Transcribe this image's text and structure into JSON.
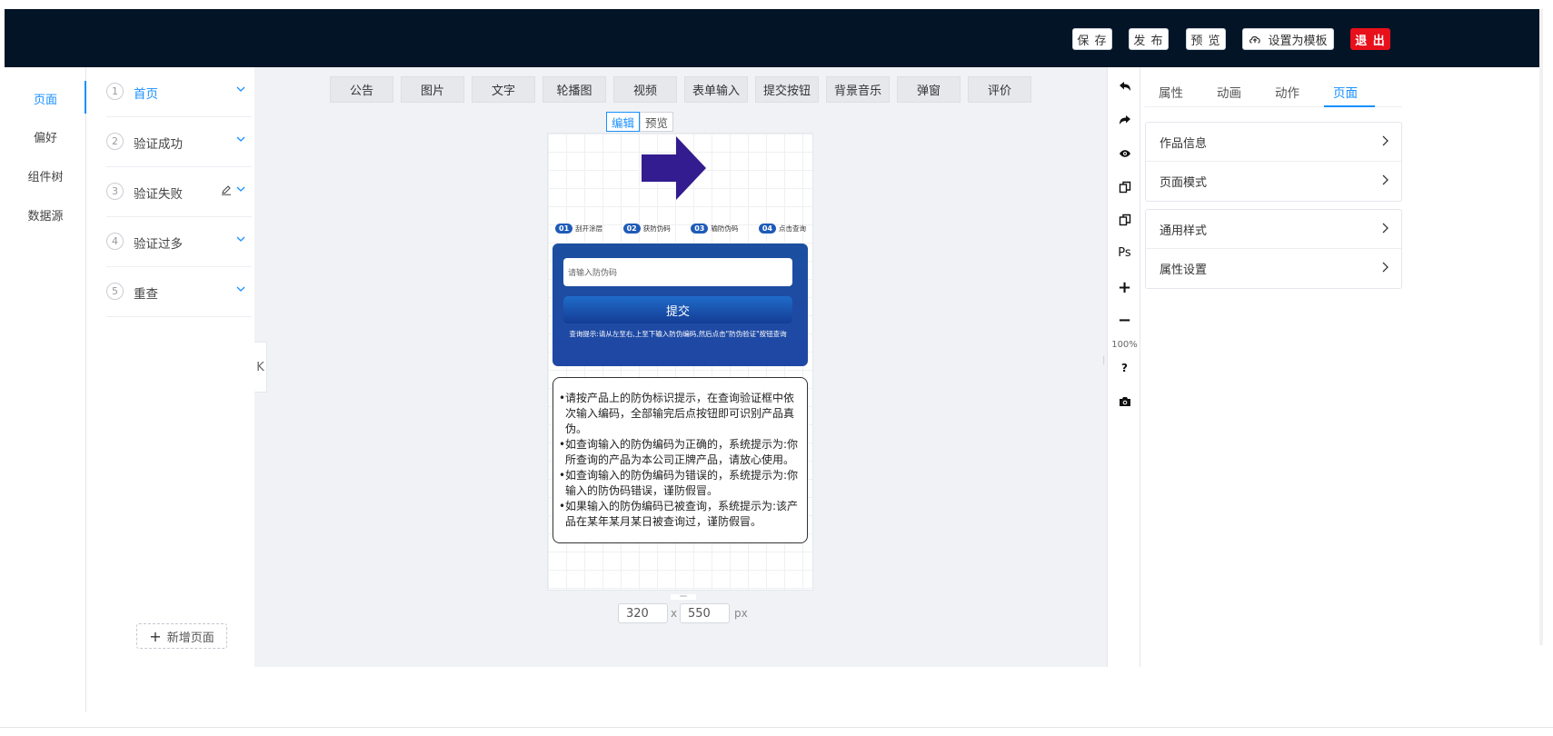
{
  "header": {
    "save": "保 存",
    "publish": "发 布",
    "preview": "预 览",
    "set_template": "设置为模板",
    "exit": "退 出"
  },
  "leftnav": {
    "items": [
      "页面",
      "偏好",
      "组件树",
      "数据源"
    ],
    "active": "页面"
  },
  "pages": [
    {
      "num": "1",
      "label": "首页",
      "active": true
    },
    {
      "num": "2",
      "label": "验证成功"
    },
    {
      "num": "3",
      "label": "验证失败"
    },
    {
      "num": "4",
      "label": "验证过多"
    },
    {
      "num": "5",
      "label": "重查"
    }
  ],
  "add_page": "新增页面",
  "components": [
    "公告",
    "图片",
    "文字",
    "轮播图",
    "视频",
    "表单输入",
    "提交按钮",
    "背景音乐",
    "弹窗",
    "评价"
  ],
  "mode": {
    "edit": "编辑",
    "preview": "预览",
    "active": "编辑"
  },
  "phone": {
    "steps": [
      {
        "badge": "01",
        "label": "刮开涂层"
      },
      {
        "badge": "02",
        "label": "获防伪码"
      },
      {
        "badge": "03",
        "label": "输防伪码"
      },
      {
        "badge": "04",
        "label": "点击查询"
      }
    ],
    "code_placeholder": "请输入防伪码",
    "submit": "提交",
    "hint": "查询提示:请从左至右,上至下输入防伪编码,然后点击\"防伪验证\"按钮查询",
    "notice": [
      "请按产品上的防伪标识提示，在查询验证框中依次输入编码，全部输完后点按钮即可识别产品真伪。",
      "如查询输入的防伪编码为正确的，系统提示为:你所查询的产品为本公司正牌产品，请放心使用。",
      "如查询输入的防伪编码为错误的，系统提示为:你输入的防伪码错误，谨防假冒。",
      "如果输入的防伪编码已被查询，系统提示为:该产品在某年某月某日被查询过，谨防假冒。"
    ]
  },
  "canvas_size": {
    "width": "320",
    "x": "x",
    "height": "550",
    "unit": "px"
  },
  "toolbar": {
    "zoom": "100%",
    "ps": "Ps",
    "help": "?"
  },
  "right_panel": {
    "tabs": [
      "属性",
      "动画",
      "动作",
      "页面"
    ],
    "active_tab": "页面",
    "group1": [
      "作品信息",
      "页面模式"
    ],
    "group2": [
      "通用样式",
      "属性设置"
    ]
  },
  "colors": {
    "header_bg": "#031427",
    "accent": "#1890ff",
    "exit": "#e8101b",
    "arrow": "#331c8f",
    "box": "#1c4fa0"
  }
}
